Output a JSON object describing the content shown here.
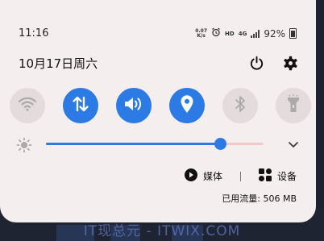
{
  "status_bar": {
    "time": "11:16",
    "net_speed_value": "0.07",
    "net_speed_unit": "K/s",
    "hd": "HD",
    "network": "4G",
    "battery": "92%"
  },
  "header": {
    "date": "10月17日周六"
  },
  "toggles": [
    {
      "name": "wifi",
      "on": false
    },
    {
      "name": "mobile-data",
      "on": true
    },
    {
      "name": "sound",
      "on": true
    },
    {
      "name": "location",
      "on": true
    },
    {
      "name": "bluetooth",
      "on": false
    },
    {
      "name": "flashlight",
      "on": false
    }
  ],
  "brightness": {
    "level": 0.8
  },
  "media": {
    "media_label": "媒体",
    "devices_label": "设备"
  },
  "data_usage": "已用流量: 506 MB",
  "background": {
    "watermark": "IT现总元 - ITWIX.COM"
  },
  "colors": {
    "accent": "#2c7be5",
    "panel": "#f5eeee",
    "toggle_off": "#e4dcdc"
  }
}
